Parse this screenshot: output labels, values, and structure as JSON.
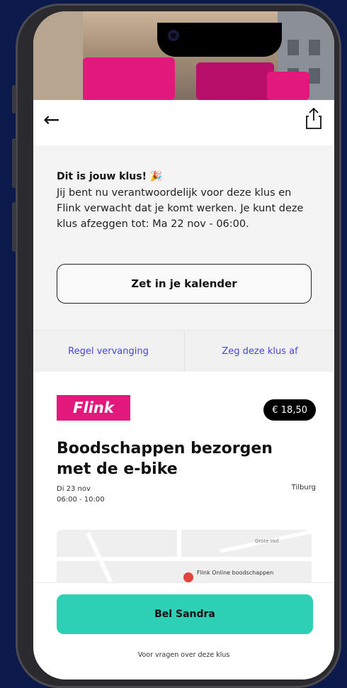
{
  "header": {
    "back_icon": "arrow-left-icon",
    "share_icon": "share-icon"
  },
  "banner": {
    "title": "Dit is jouw klus!",
    "emoji": "🎉",
    "message": "Jij bent nu verantwoordelijk voor deze klus en Flink verwacht dat je komt werken. Je kunt deze klus afzeggen tot: Ma 22 nov - 06:00.",
    "calendar_button": "Zet in je kalender"
  },
  "actions": {
    "replace": "Regel vervanging",
    "cancel": "Zeg deze klus af"
  },
  "job": {
    "company_logo_text": "Flink",
    "price": "€ 18,50",
    "title": "Boodschappen bezorgen met de e-bike",
    "date": "Di 23 nov",
    "time": "06:00 - 10:00",
    "city": "Tilburg"
  },
  "map": {
    "place_label": "Flink Online boodschappen",
    "street_label": "Grote Hof"
  },
  "footer": {
    "call_button": "Bel Sandra",
    "hint": "Voor vragen over deze klus"
  },
  "colors": {
    "accent_pink": "#e3187d",
    "call_button": "#2dcfb5",
    "link_blue": "#4646d8",
    "background": "#0b1a4a"
  }
}
